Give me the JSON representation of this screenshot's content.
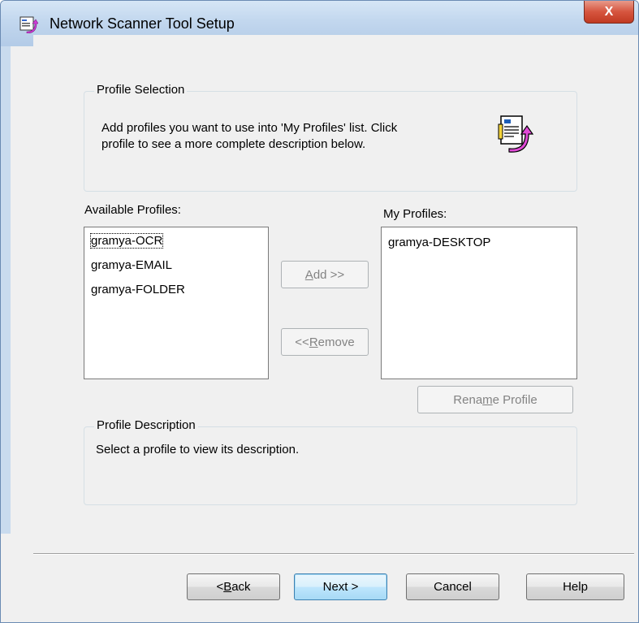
{
  "window": {
    "title": "Network Scanner Tool Setup",
    "close_label": "X"
  },
  "profile_selection": {
    "legend": "Profile Selection",
    "description_line1": "Add profiles you want to use into 'My Profiles' list. Click",
    "description_line2": "profile to see a more complete description below."
  },
  "available_profiles": {
    "label": "Available Profiles:",
    "items": [
      "gramya-OCR",
      "gramya-EMAIL",
      "gramya-FOLDER"
    ]
  },
  "my_profiles": {
    "label": "My Profiles:",
    "items": [
      "gramya-DESKTOP"
    ]
  },
  "buttons": {
    "add_pre": "",
    "add_accel": "A",
    "add_post": "dd >>",
    "remove_pre": "<< ",
    "remove_accel": "R",
    "remove_post": "emove",
    "rename_pre": "Rena",
    "rename_accel": "m",
    "rename_post": "e Profile",
    "back_pre": "< ",
    "back_accel": "B",
    "back_post": "ack",
    "next": "Next >",
    "cancel": "Cancel",
    "help": "Help"
  },
  "profile_description": {
    "legend": "Profile Description",
    "text": "Select a profile to view its description."
  },
  "colors": {
    "titlebar": "#c2d7ee",
    "close_button": "#c13a22",
    "dialog_bg": "#f0f0f0",
    "default_button_border": "#3c7fb1"
  }
}
